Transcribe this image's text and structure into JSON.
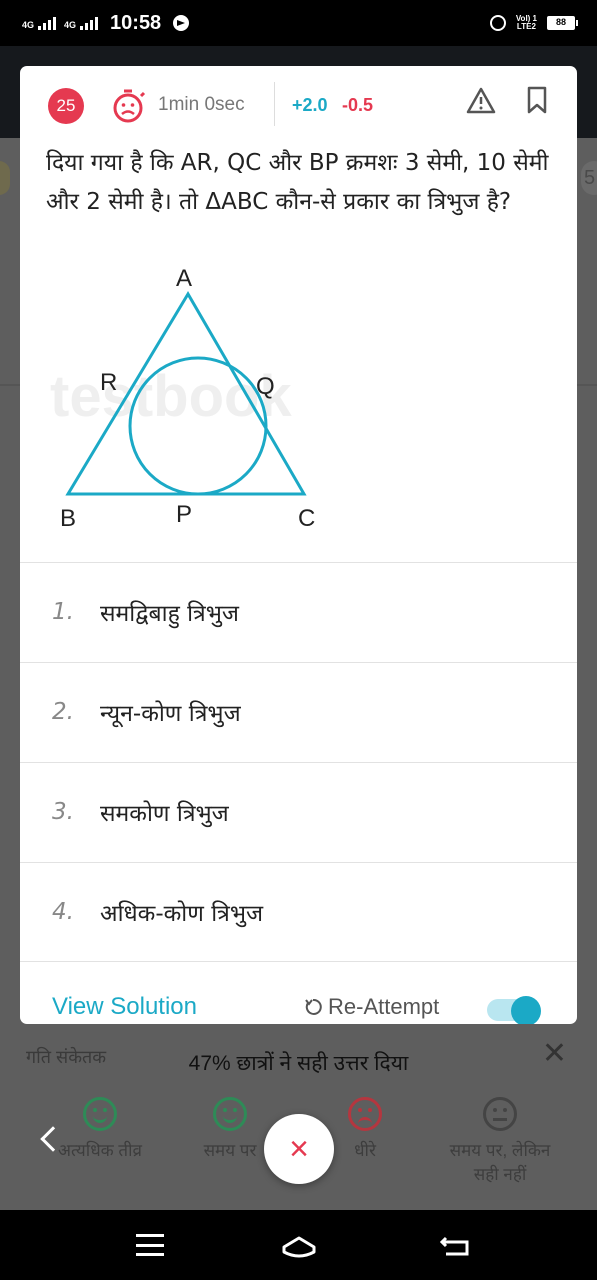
{
  "status_bar": {
    "network1": "4G",
    "network2": "4G",
    "time": "10:58",
    "volte_line1": "Vol) 1",
    "volte_line2": "LTE2",
    "battery": "88"
  },
  "background": {
    "speed_label": "गति संकेतक",
    "stat_text": "47% छात्रों ने सही उत्तर दिया",
    "speed_items": [
      {
        "label_line1": "अत्यधिक तीव्र",
        "label_line2": "",
        "face": "happy",
        "color": "#2e8b57"
      },
      {
        "label_line1": "समय पर",
        "label_line2": "",
        "face": "happy",
        "color": "#2e8b57"
      },
      {
        "label_line1": "धीरे",
        "label_line2": "",
        "face": "sad",
        "color": "#b5363f"
      },
      {
        "label_line1": "समय पर, लेकिन",
        "label_line2": "सही नहीं",
        "face": "neutral",
        "color": "#444444"
      }
    ],
    "close_glyph": "✕",
    "fab_glyph": "×"
  },
  "card": {
    "question_number": "25",
    "time_taken": "1min 0sec",
    "marks_positive": "+2.0",
    "marks_negative": "-0.5",
    "question_text": "दिया गया है कि AR, QC और BP क्रमशः 3 सेमी, 10 सेमी और 2 सेमी है। तो ΔABC कौन-से प्रकार का त्रिभुज है?",
    "figure": {
      "watermark": "testbook",
      "labels": {
        "A": "A",
        "B": "B",
        "C": "C",
        "P": "P",
        "Q": "Q",
        "R": "R"
      }
    },
    "options": [
      {
        "num": "1.",
        "text": "समद्विबाहु त्रिभुज"
      },
      {
        "num": "2.",
        "text": "न्यून-कोण त्रिभुज"
      },
      {
        "num": "3.",
        "text": "समकोण त्रिभुज"
      },
      {
        "num": "4.",
        "text": "अधिक-कोण त्रिभुज"
      }
    ],
    "view_solution": "View Solution",
    "reattempt": "Re-Attempt",
    "toggle_on": true
  },
  "colors": {
    "accent": "#1ba9c6",
    "danger": "#e53950"
  }
}
